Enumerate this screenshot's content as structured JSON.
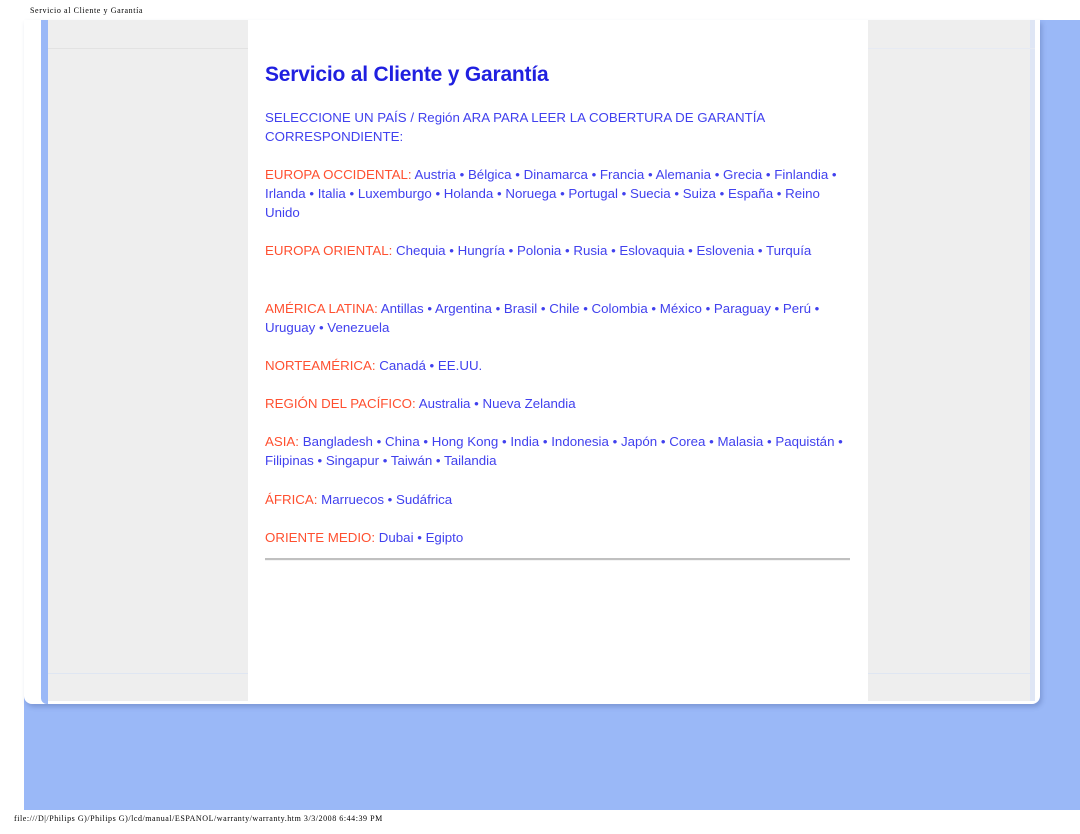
{
  "print_header": "Servicio al Cliente y Garantía",
  "print_footer": "file:///D|/Philips G)/Philips G)/lcd/manual/ESPANOL/warranty/warranty.htm 3/3/2008 6:44:39 PM",
  "colors": {
    "title_blue": "#2020e0",
    "link_blue": "#4141ee",
    "heading_orange": "#ff5030",
    "page_backdrop": "#9ab8f7",
    "side_panel_gray": "#eeeeee"
  },
  "page": {
    "title": "Servicio al Cliente y Garantía",
    "intro": "SELECCIONE UN PAÍS / Región ARA PARA LEER LA COBERTURA DE GARANTÍA CORRESPONDIENTE:",
    "regions": [
      {
        "id": "europa-occidental",
        "heading": "EUROPA OCCIDENTAL:",
        "countries": "Austria • Bélgica • Dinamarca • Francia • Alemania • Grecia • Finlandia • Irlanda • Italia • Luxemburgo • Holanda • Noruega • Portugal • Suecia • Suiza • España • Reino Unido"
      },
      {
        "id": "europa-oriental",
        "heading": "EUROPA ORIENTAL:",
        "countries": "Chequia • Hungría • Polonia • Rusia • Eslovaquia • Eslovenia • Turquía"
      },
      {
        "id": "america-latina",
        "heading": "AMÉRICA LATINA:",
        "countries": "Antillas • Argentina • Brasil • Chile • Colombia • México • Paraguay • Perú • Uruguay • Venezuela"
      },
      {
        "id": "norteamerica",
        "heading": "NORTEAMÉRICA:",
        "countries": "Canadá • EE.UU."
      },
      {
        "id": "region-del-pacifico",
        "heading": "REGIÓN DEL PACÍFICO:",
        "countries": "Australia • Nueva Zelandia"
      },
      {
        "id": "asia",
        "heading": "ASIA:",
        "countries": "Bangladesh • China • Hong Kong • India • Indonesia • Japón • Corea • Malasia • Paquistán • Filipinas • Singapur • Taiwán • Tailandia"
      },
      {
        "id": "africa",
        "heading": "ÁFRICA:",
        "countries": "Marruecos • Sudáfrica"
      },
      {
        "id": "oriente-medio",
        "heading": "ORIENTE MEDIO:",
        "countries": "Dubai • Egipto"
      }
    ]
  }
}
